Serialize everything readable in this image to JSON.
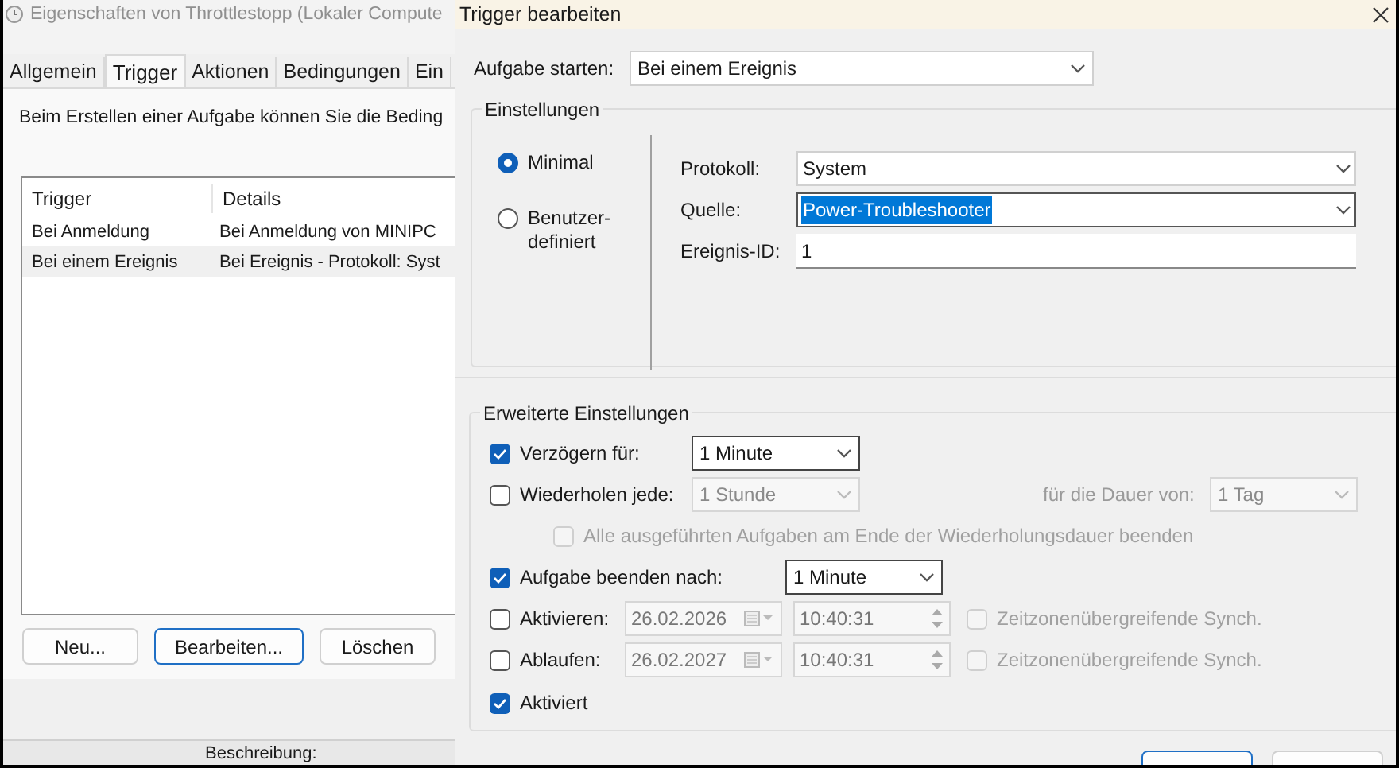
{
  "back_window": {
    "title": "Eigenschaften von Throttlestopp (Lokaler Compute",
    "tabs": [
      {
        "label": "Allgemein",
        "selected": false
      },
      {
        "label": "Trigger",
        "selected": true
      },
      {
        "label": "Aktionen",
        "selected": false
      },
      {
        "label": "Bedingungen",
        "selected": false
      },
      {
        "label": "Ein",
        "selected": false
      }
    ],
    "intro": "Beim Erstellen einer Aufgabe können Sie die Beding",
    "table": {
      "columns": [
        "Trigger",
        "Details"
      ],
      "rows": [
        {
          "cells": [
            "Bei Anmeldung",
            "Bei Anmeldung von MINIPC"
          ],
          "selected": false
        },
        {
          "cells": [
            "Bei einem Ereignis",
            "Bei Ereignis - Protokoll: Syst"
          ],
          "selected": true
        }
      ]
    },
    "buttons": [
      {
        "label": "Neu...",
        "default": false
      },
      {
        "label": "Bearbeiten...",
        "default": true
      },
      {
        "label": "Löschen",
        "default": false
      }
    ],
    "status_label": "Beschreibung:"
  },
  "dialog": {
    "title": "Trigger bearbeiten",
    "start": {
      "label": "Aufgabe starten:",
      "value": "Bei einem Ereignis"
    },
    "settings": {
      "title": "Einstellungen",
      "modes": [
        {
          "label": "Minimal",
          "selected": true
        },
        {
          "label": "Benutzer-definiert",
          "selected": false
        }
      ],
      "fields": [
        {
          "label": "Protokoll:",
          "value": "System",
          "kind": "dropdown",
          "highlighted": false
        },
        {
          "label": "Quelle:",
          "value": "Power-Troubleshooter",
          "kind": "dropdown",
          "highlighted": true
        },
        {
          "label": "Ereignis-ID:",
          "value": "1",
          "kind": "text",
          "highlighted": false
        }
      ]
    },
    "advanced": {
      "title": "Erweiterte Einstellungen",
      "delay": {
        "label": "Verzögern für:",
        "checked": true,
        "value": "1 Minute"
      },
      "repeat": {
        "label": "Wiederholen jede:",
        "checked": false,
        "value": "1 Stunde",
        "duration_label": "für die Dauer von:",
        "duration_value": "1 Tag"
      },
      "stop_all": {
        "label": "Alle ausgeführten Aufgaben am Ende der Wiederholungsdauer beenden",
        "checked": false
      },
      "stop_after": {
        "label": "Aufgabe beenden nach:",
        "checked": true,
        "value": "1 Minute"
      },
      "dates": [
        {
          "label": "Aktivieren:",
          "checked": false,
          "date": "26.02.2026",
          "time": "10:40:31",
          "sync_label": "Zeitzonenübergreifende Synch.",
          "sync_checked": false
        },
        {
          "label": "Ablaufen:",
          "checked": false,
          "date": "26.02.2027",
          "time": "10:40:31",
          "sync_label": "Zeitzonenübergreifende Synch.",
          "sync_checked": false
        }
      ],
      "enabled": {
        "label": "Aktiviert",
        "checked": true
      }
    }
  }
}
